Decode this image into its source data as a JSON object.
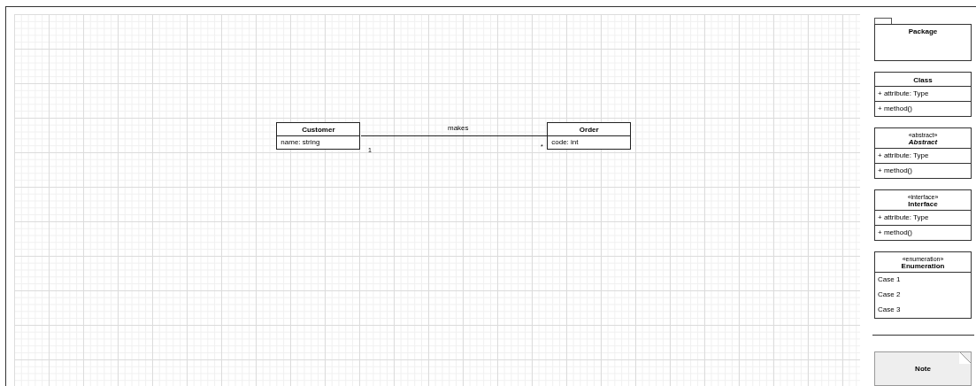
{
  "canvas": {
    "classes": [
      {
        "name": "Customer",
        "attributes": [
          "name: string"
        ]
      },
      {
        "name": "Order",
        "attributes": [
          "code: int"
        ]
      }
    ],
    "association": {
      "label": "makes",
      "source_multiplicity": "1",
      "target_multiplicity": "*"
    }
  },
  "palette": [
    {
      "kind": "package",
      "name": "Package"
    },
    {
      "kind": "class",
      "name": "Class",
      "rows": [
        "+ attribute: Type",
        "+ method()"
      ]
    },
    {
      "kind": "abstract",
      "stereotype": "«abstract»",
      "name": "Abstract",
      "rows": [
        "+ attribute: Type",
        "+ method()"
      ]
    },
    {
      "kind": "class",
      "stereotype": "«interface»",
      "name": "Interface",
      "rows": [
        "+ attribute: Type",
        "+ method()"
      ]
    },
    {
      "kind": "enumeration",
      "stereotype": "«enumeration»",
      "name": "Enumeration",
      "rows": [
        "Case 1",
        "Case 2",
        "Case 3"
      ]
    },
    {
      "kind": "note",
      "name": "Note"
    }
  ]
}
